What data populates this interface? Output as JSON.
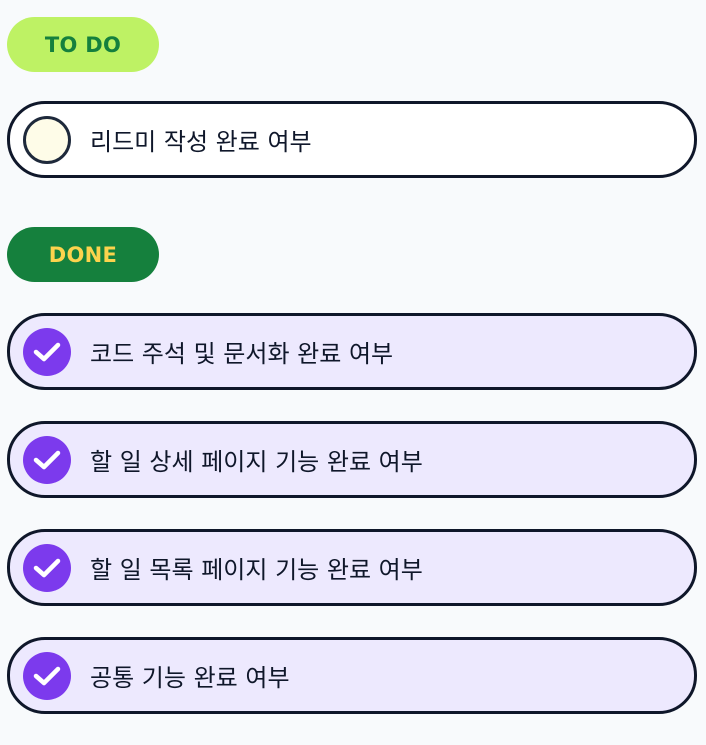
{
  "todo": {
    "badge_label": "TO DO",
    "items": [
      {
        "label": "리드미 작성 완료 여부",
        "done": false
      }
    ]
  },
  "done": {
    "badge_label": "DONE",
    "items": [
      {
        "label": "코드 주석 및 문서화 완료 여부",
        "done": true
      },
      {
        "label": "할 일 상세 페이지 기능 완료 여부",
        "done": true
      },
      {
        "label": "할 일 목록 페이지 기능 완료 여부",
        "done": true
      },
      {
        "label": "공통 기능 완료 여부",
        "done": true
      }
    ]
  },
  "colors": {
    "todo_badge_bg": "#bef264",
    "todo_badge_text": "#15803d",
    "done_badge_bg": "#15803d",
    "done_badge_text": "#fcd34d",
    "check_done": "#7c3aed",
    "done_item_bg": "#ede9fe"
  },
  "icons": {
    "unchecked": "empty-circle-icon",
    "checked": "checkmark-icon"
  }
}
